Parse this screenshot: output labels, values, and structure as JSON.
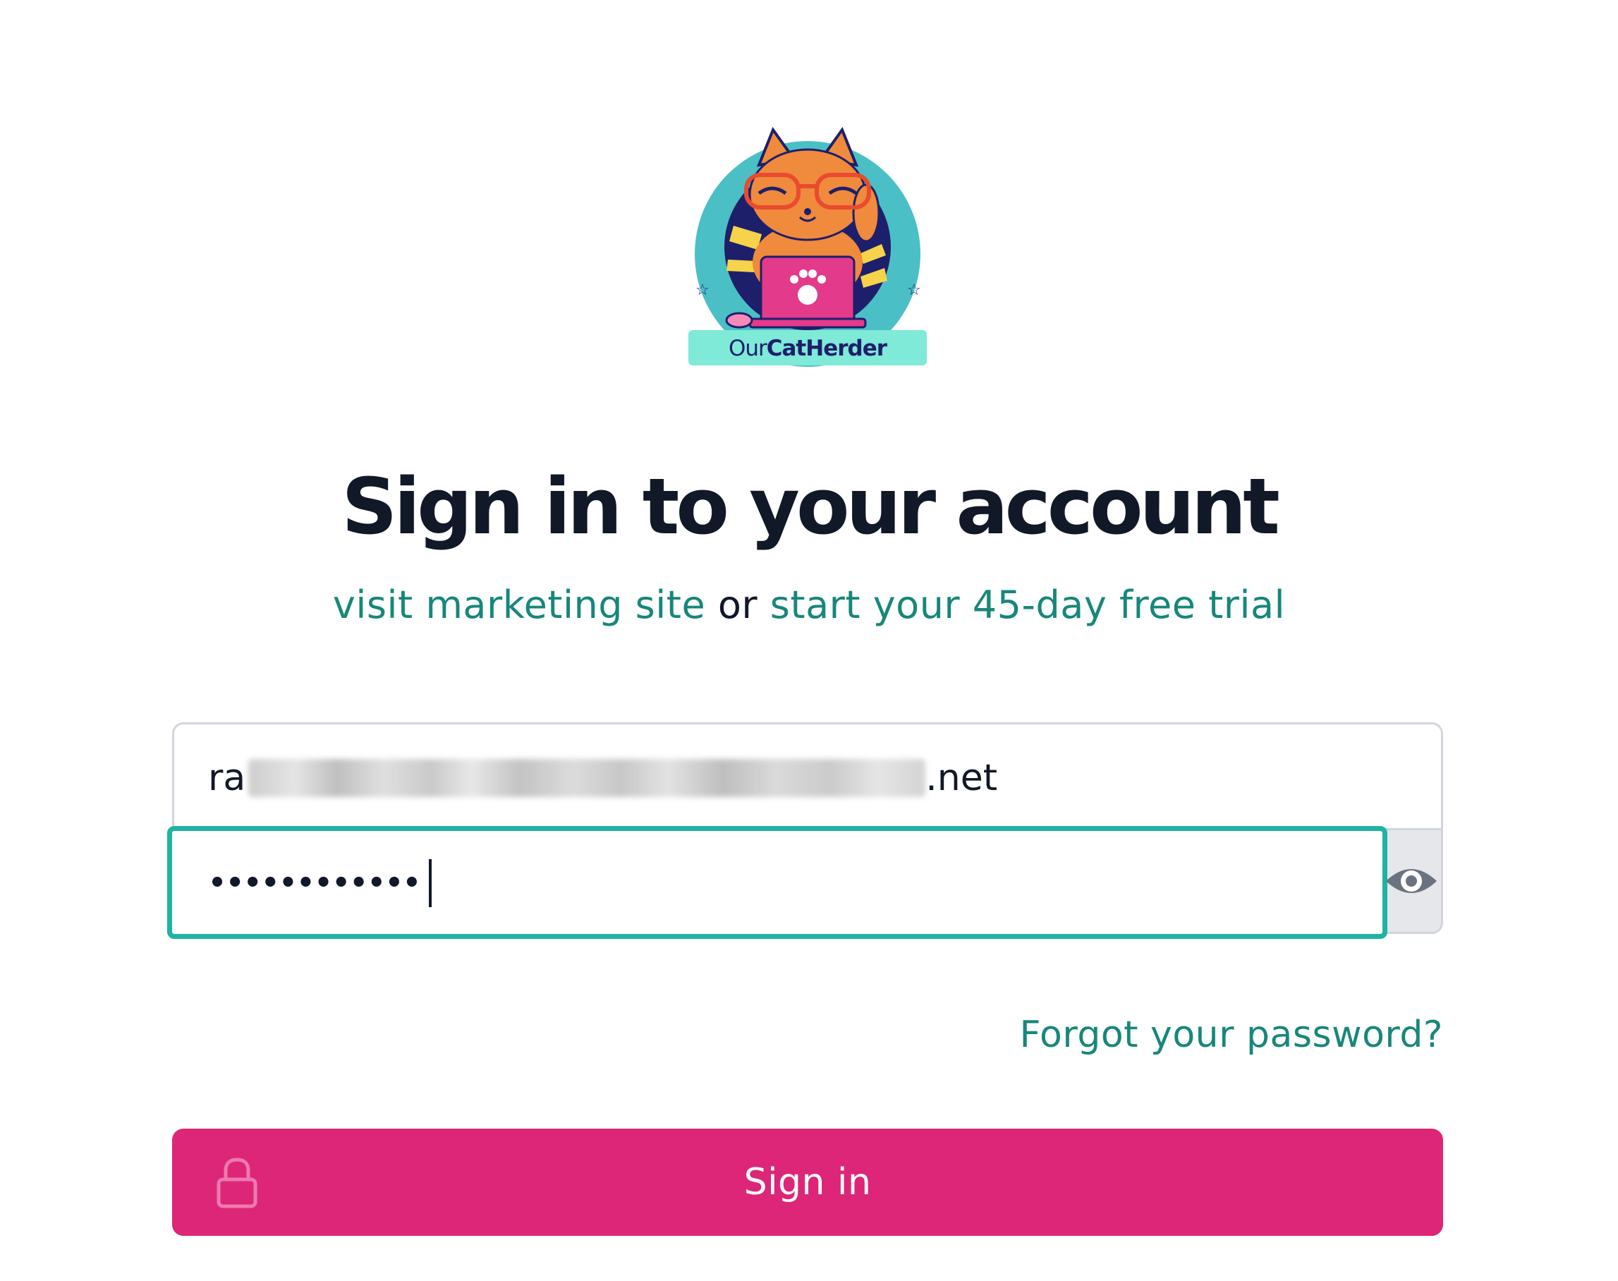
{
  "brand": {
    "logo_text_our": "Our",
    "logo_text_cat": "Cat",
    "logo_text_herder": "Herder"
  },
  "heading": {
    "title": "Sign in to your account",
    "marketing_link": "visit marketing site",
    "connector": "or",
    "trial_link": "start your 45-day free trial"
  },
  "form": {
    "email_prefix": "ra",
    "email_suffix": ".net",
    "password_masked": "••••••••••••",
    "password_visibility_icon": "eye-icon",
    "forgot_link": "Forgot your password?",
    "submit_label": "Sign in",
    "submit_icon": "lock-icon"
  },
  "colors": {
    "accent_link": "#17877a",
    "focus_ring": "#1fb3a3",
    "button": "#dd2677",
    "heading": "#111827"
  }
}
